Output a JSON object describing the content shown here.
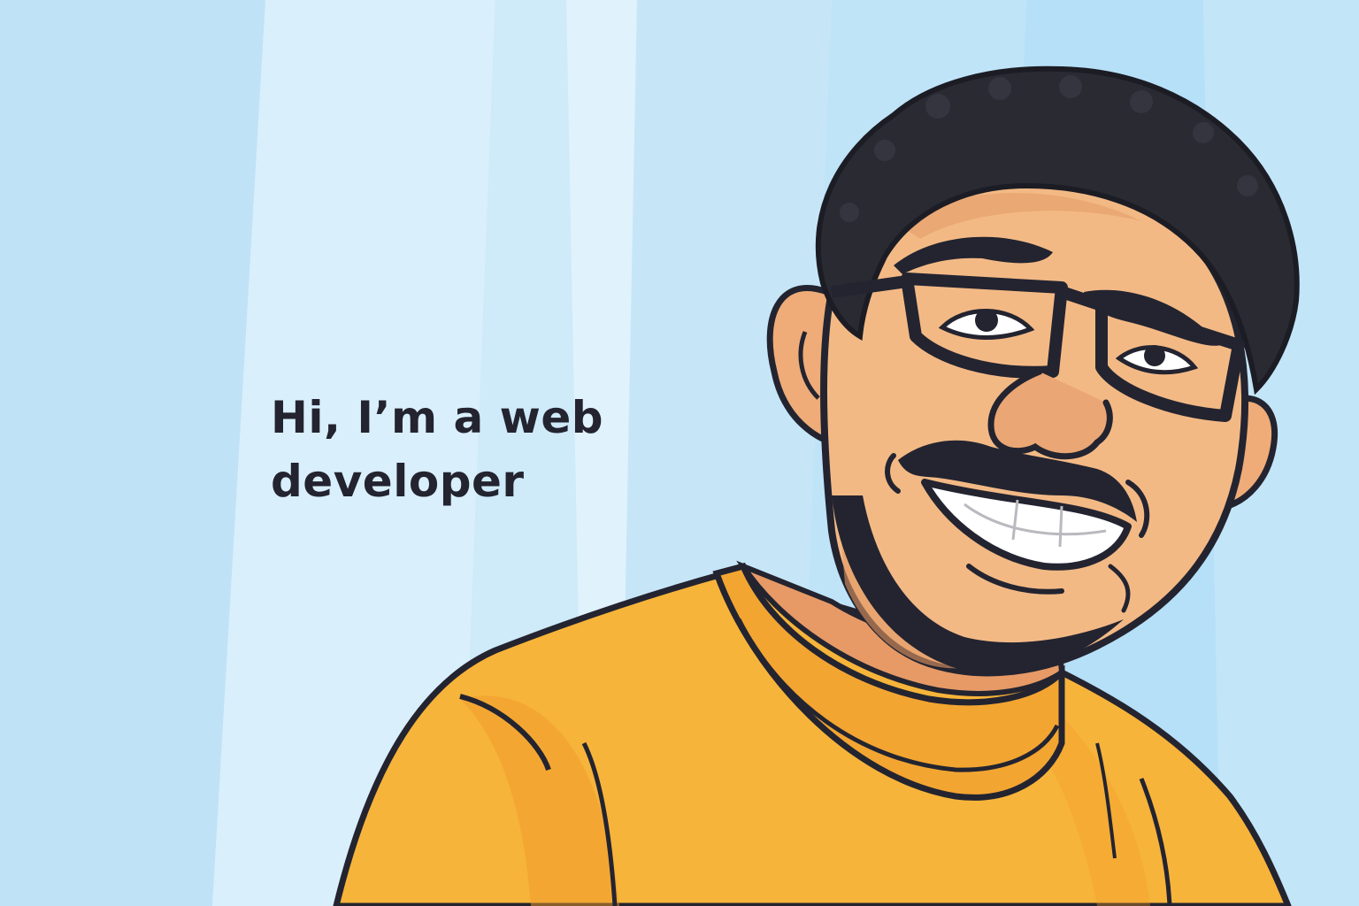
{
  "headline": {
    "line1": "Hi, I’m a web",
    "line2": "developer"
  },
  "colors": {
    "background": "#cfeaf8",
    "shirt": "#f7b43a",
    "skin": "#efac78",
    "outline": "#232430"
  }
}
